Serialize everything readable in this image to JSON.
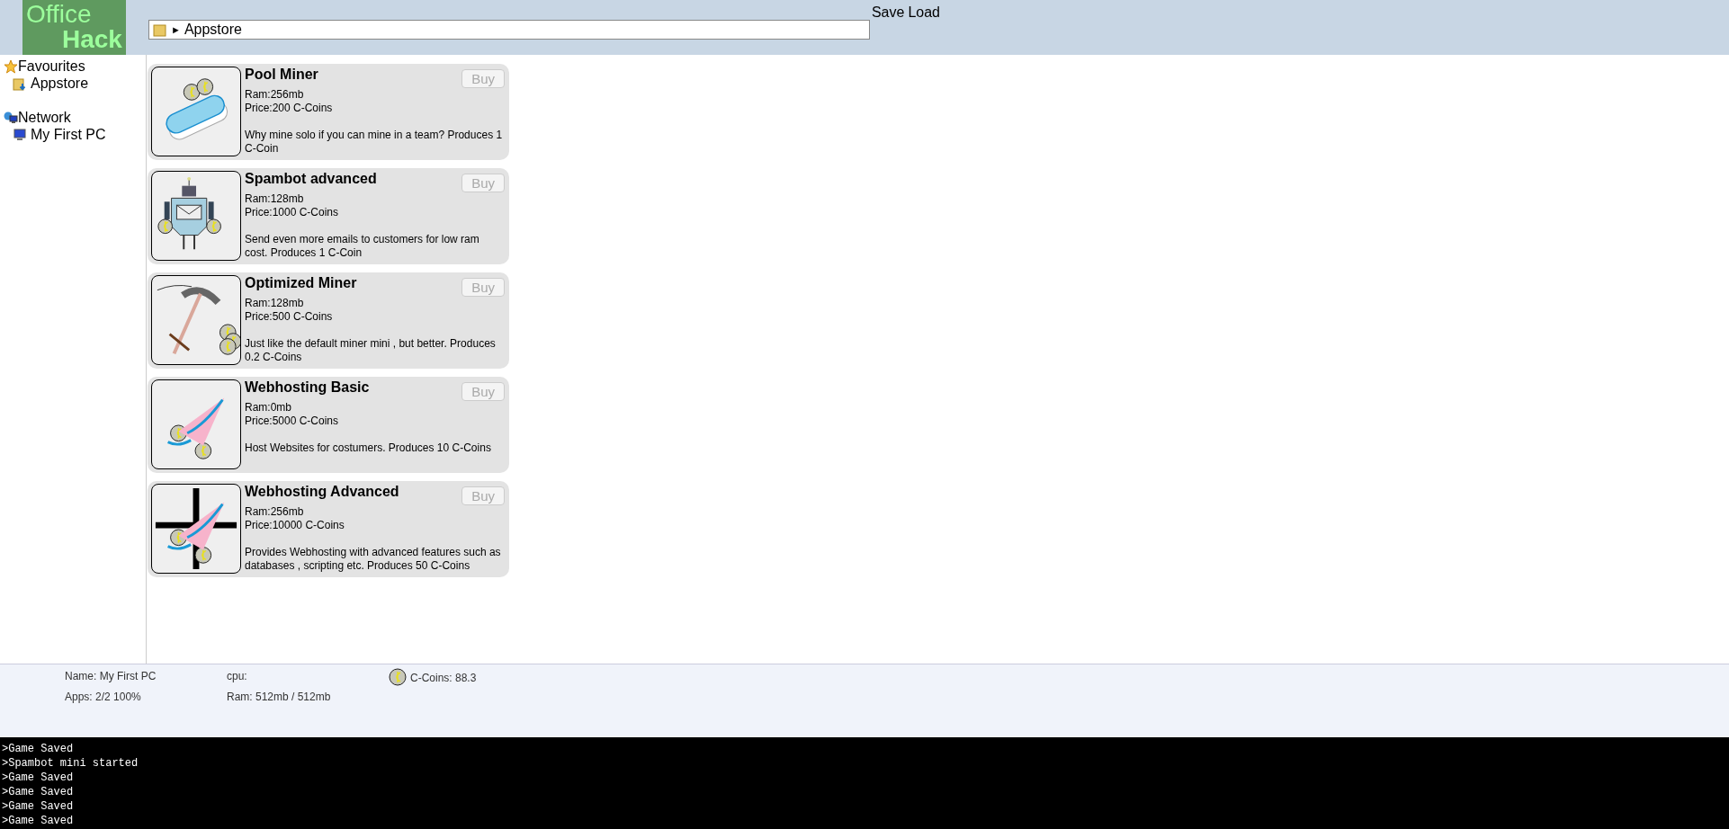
{
  "logo": {
    "line1": "Office",
    "line2": "Hack"
  },
  "header": {
    "actions": [
      "Save",
      "Load"
    ],
    "address": {
      "separator": "►",
      "location": "Appstore"
    }
  },
  "sidebar": {
    "sections": [
      {
        "label": "Favourites",
        "kind": "star",
        "children": [
          {
            "label": "Appstore",
            "kind": "folder"
          }
        ]
      },
      {
        "label": "Network",
        "kind": "network",
        "children": [
          {
            "label": "My First PC",
            "kind": "computer"
          }
        ]
      }
    ]
  },
  "apps": [
    {
      "name": "Pool Miner",
      "kind": "pool",
      "ram": "Ram:256mb",
      "price": "Price:200 C-Coins",
      "description": "Why mine solo if you can mine in a team? Produces 1 C-Coin",
      "button": {
        "label": "Buy",
        "disabled": true
      }
    },
    {
      "name": "Spambot advanced",
      "kind": "robot",
      "ram": "Ram:128mb",
      "price": "Price:1000 C-Coins",
      "description": "Send even more emails to customers for low ram cost. Produces 1 C-Coin",
      "button": {
        "label": "Buy",
        "disabled": true
      }
    },
    {
      "name": "Optimized Miner",
      "kind": "pickaxe",
      "ram": "Ram:128mb",
      "price": "Price:500 C-Coins",
      "description": "Just like the default miner mini , but better. Produces 0.2 C-Coins",
      "button": {
        "label": "Buy",
        "disabled": true
      }
    },
    {
      "name": "Webhosting Basic",
      "kind": "web",
      "ram": "Ram:0mb",
      "price": "Price:5000 C-Coins",
      "description": "Host Websites for costumers. Produces 10 C-Coins",
      "button": {
        "label": "Buy",
        "disabled": true
      }
    },
    {
      "name": "Webhosting Advanced",
      "kind": "web-advanced",
      "ram": "Ram:256mb",
      "price": "Price:10000 C-Coins",
      "description": "Provides Webhosting with advanced features such as databases , scripting etc. Produces 50 C-Coins",
      "button": {
        "label": "Buy",
        "disabled": true
      }
    }
  ],
  "status": {
    "name": "Name: My First PC",
    "apps": "Apps: 2/2 100%",
    "cpu": "cpu:",
    "ram": "Ram: 512mb / 512mb",
    "coins": "C-Coins: 88.3"
  },
  "console": [
    ">Game Saved",
    ">Spambot mini started",
    ">Game Saved",
    ">Game Saved",
    ">Game Saved",
    ">Game Saved"
  ]
}
